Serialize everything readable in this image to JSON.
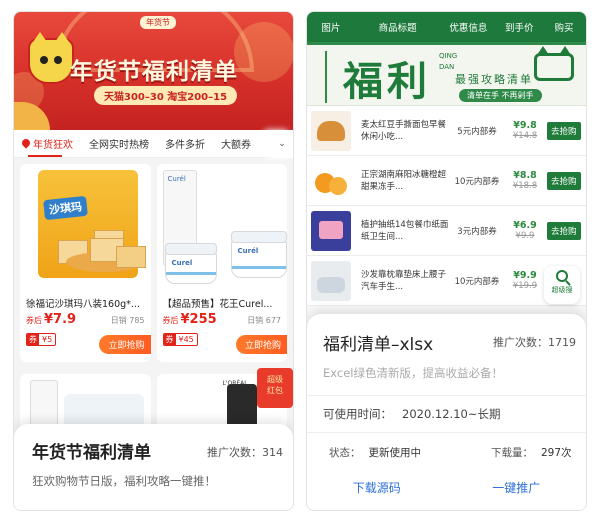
{
  "left": {
    "banner": {
      "badge": "年货节",
      "title": "年货节福利清单",
      "subtitle": "天猫300–30 淘宝200–15"
    },
    "tabs": [
      "年货狂欢",
      "全网实时热榜",
      "多件多折",
      "大额券"
    ],
    "products": [
      {
        "name": "徐福记沙琪玛八装160g*...",
        "price_label": "券后",
        "price": "¥7.9",
        "sold": "日销 785",
        "coupon_icon": "券",
        "coupon_value": "¥5",
        "buy_label": "立即抢购",
        "bag_logo": "沙琪玛"
      },
      {
        "name": "【超品预售】花王Curel...",
        "price_label": "券后",
        "price": "¥255",
        "sold": "日销 677",
        "coupon_icon": "券",
        "coupon_value": "¥45",
        "buy_label": "立即抢购",
        "box_label": "Curél"
      }
    ],
    "hongbao": "超级\n红包",
    "info": {
      "title": "年货节福利清单",
      "promo_count": "推广次数：314",
      "desc": "狂欢购物节日版，福利攻略一键推！"
    }
  },
  "right": {
    "headers": [
      "图片",
      "商品标题",
      "优惠信息",
      "到手价",
      "购买"
    ],
    "fuli": {
      "big": "福利",
      "vertical": "QING DAN",
      "slogan": "最强攻略清单",
      "pill": "清单在手 不再剁手"
    },
    "rows": [
      {
        "title": "麦太红豆手撕面包早餐休闲小吃...",
        "coupon": "5元内部券",
        "price": "¥9.8",
        "orig": "¥14.8",
        "go": "去抢购"
      },
      {
        "title": "正宗湖南麻阳冰糖橙超甜果冻手...",
        "coupon": "10元内部券",
        "price": "¥8.8",
        "orig": "¥18.8",
        "go": "去抢购"
      },
      {
        "title": "植护抽纸14包餐巾纸面纸卫生间...",
        "coupon": "3元内部券",
        "price": "¥6.9",
        "orig": "¥9.9",
        "go": "去抢购"
      },
      {
        "title": "沙发靠枕靠垫床上腰子汽车手生...",
        "coupon": "10元内部券",
        "price": "¥9.9",
        "orig": "¥19.9",
        "go": "去抢购"
      }
    ],
    "search_label": "超级搜",
    "info": {
      "title": "福利清单–xlsx",
      "promo_count": "推广次数：1719",
      "desc": "Excel绿色清新版，提高收益必备！",
      "time_label": "可使用时间：",
      "time_value": "2020.12.10~长期",
      "status_label": "状态：",
      "status_value": "更新使用中",
      "downloads_label": "下载量：",
      "downloads_value": "297次",
      "download_source": "下载源码",
      "one_click": "一键推广"
    }
  },
  "colors": {
    "red": "#e2231a",
    "green": "#1f7b3a",
    "blue_link": "#2d6fd6"
  }
}
